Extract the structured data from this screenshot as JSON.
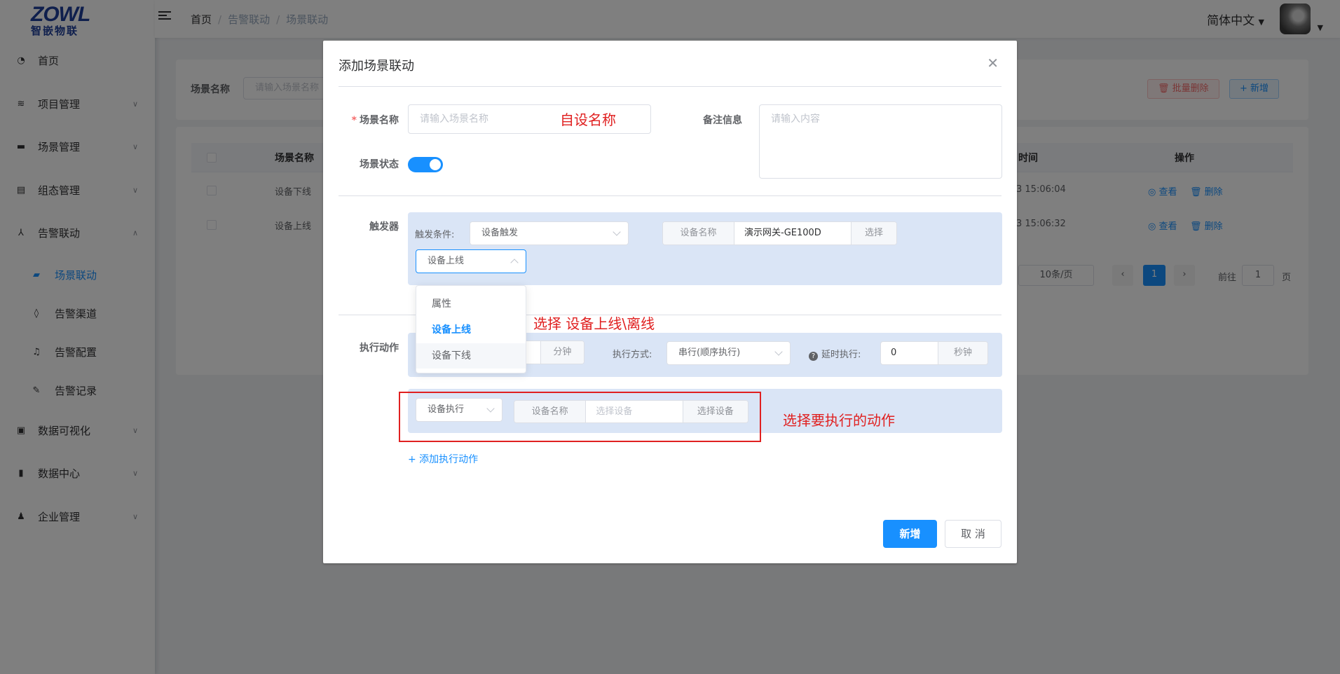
{
  "logo": {
    "main": "ZOWL",
    "sub": "智嵌物联"
  },
  "sidebar": {
    "items": [
      {
        "label": "首页",
        "icon": "dashboard-icon"
      },
      {
        "label": "项目管理",
        "icon": "layers-icon"
      },
      {
        "label": "场景管理",
        "icon": "clapper-icon"
      },
      {
        "label": "组态管理",
        "icon": "grid-icon"
      },
      {
        "label": "告警联动",
        "icon": "share-icon"
      },
      {
        "label": "场景联动",
        "icon": "video-icon"
      },
      {
        "label": "告警渠道",
        "icon": "channel-icon"
      },
      {
        "label": "告警配置",
        "icon": "bell-icon"
      },
      {
        "label": "告警记录",
        "icon": "edit-icon"
      },
      {
        "label": "数据可视化",
        "icon": "monitor-icon"
      },
      {
        "label": "数据中心",
        "icon": "chart-icon"
      },
      {
        "label": "企业管理",
        "icon": "user-icon"
      }
    ]
  },
  "header": {
    "breadcrumb": [
      "首页",
      "告警联动",
      "场景联动"
    ],
    "language": "简体中文"
  },
  "background": {
    "search_label": "场景名称",
    "search_placeholder": "请输入场景名称",
    "batch_delete": "批量删除",
    "add_new": "+ 新增",
    "columns": [
      "场景名称",
      "时间",
      "操作"
    ],
    "rows": [
      {
        "name": "设备下线",
        "time": "3 15:06:04"
      },
      {
        "name": "设备上线",
        "time": "3 15:06:32"
      }
    ],
    "op_view": "查看",
    "op_delete": "删除",
    "page_size": "10条/页",
    "current_page": "1",
    "goto_label": "前往",
    "goto_value": "1",
    "page_unit": "页"
  },
  "dialog": {
    "title": "添加场景联动",
    "scene_name_label": "场景名称",
    "scene_name_placeholder": "请输入场景名称",
    "remark_label": "备注信息",
    "remark_placeholder": "请输入内容",
    "status_label": "场景状态",
    "trigger_label": "触发器",
    "trigger_condition_label": "触发条件:",
    "trigger_condition_value": "设备触发",
    "device_name_prefix": "设备名称",
    "device_name_value": "演示网关-GE100D",
    "select_btn": "选择",
    "event_select_value": "设备上线",
    "dropdown_options": [
      "属性",
      "设备上线",
      "设备下线"
    ],
    "action_label": "执行动作",
    "minute_unit": "分钟",
    "exec_mode_label": "执行方式:",
    "exec_mode_value": "串行(顺序执行)",
    "delay_label": "延时执行:",
    "delay_value": "0",
    "second_unit": "秒钟",
    "action_type_value": "设备执行",
    "action_device_prefix": "设备名称",
    "action_device_placeholder": "选择设备",
    "action_select_btn": "选择设备",
    "add_action_link": "+ 添加执行动作",
    "submit_btn": "新增",
    "cancel_btn": "取 消"
  },
  "annotations": {
    "name_note": "自设名称",
    "event_note": "选择 设备上线\\离线",
    "action_note": "选择要执行的动作"
  }
}
